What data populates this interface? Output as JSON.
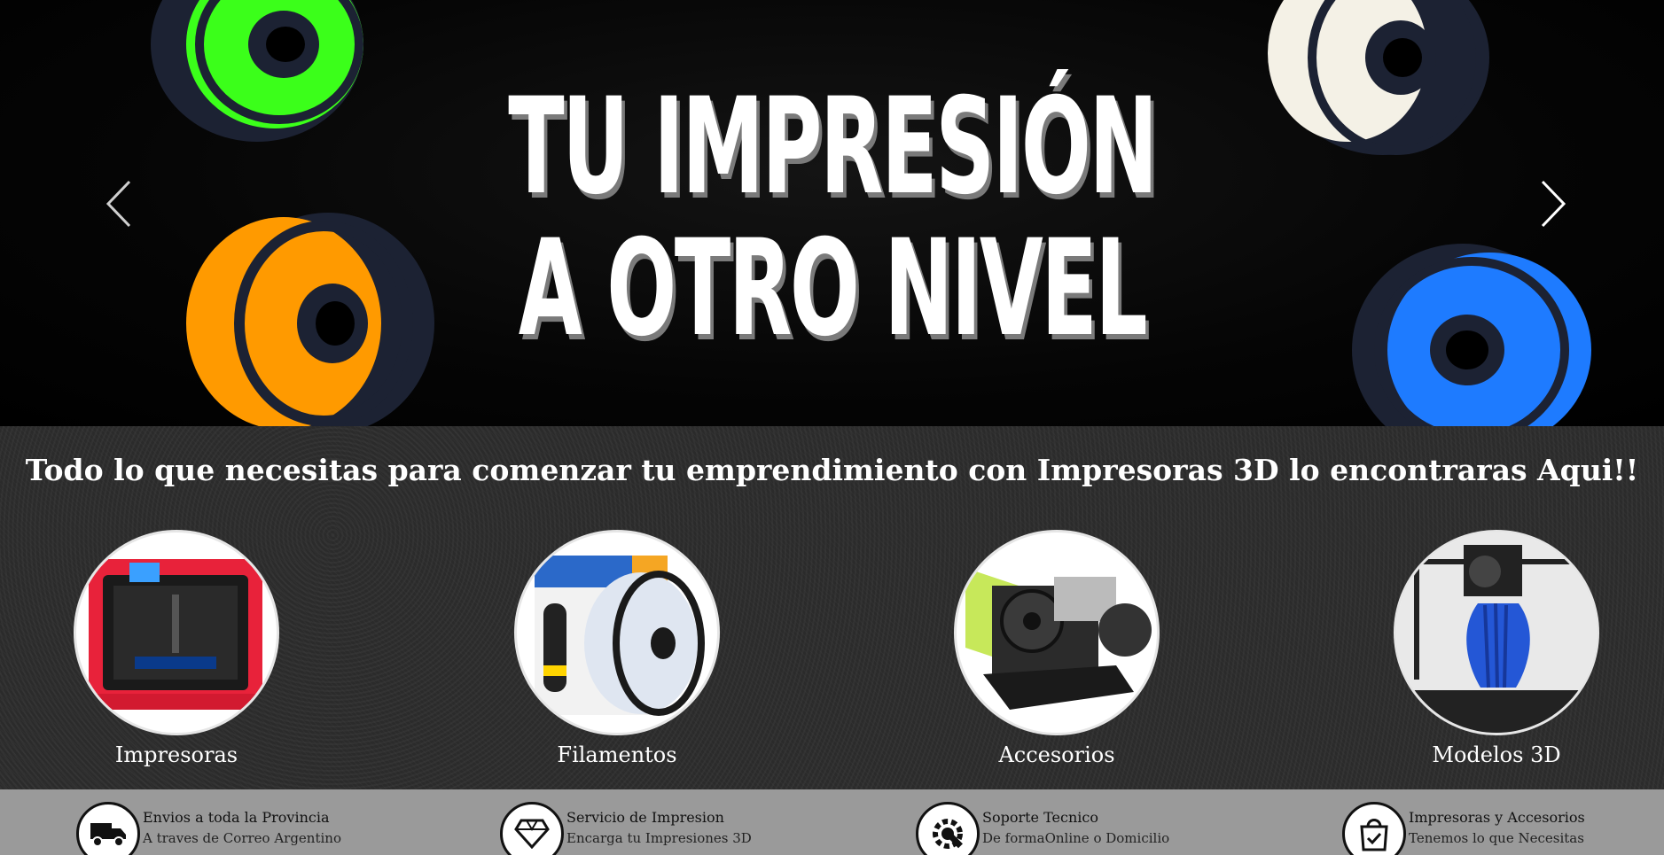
{
  "hero": {
    "title_line1": "TU IMPRESIÓN",
    "title_line2": "A OTRO NIVEL",
    "prev_icon": "chevron-left-icon",
    "next_icon": "chevron-right-icon"
  },
  "categories": {
    "heading": "Todo lo que necesitas para comenzar tu emprendimiento con Impresoras 3D lo encontraras Aqui!!",
    "items": [
      {
        "label": "Impresoras"
      },
      {
        "label": "Filamentos"
      },
      {
        "label": "Accesorios"
      },
      {
        "label": "Modelos 3D"
      }
    ]
  },
  "features": [
    {
      "icon": "truck-icon",
      "title": "Envios a toda la Provincia",
      "subtitle": "A traves de Correo Argentino"
    },
    {
      "icon": "diamond-icon",
      "title": "Servicio de Impresion",
      "subtitle": "Encarga tu Impresiones 3D"
    },
    {
      "icon": "gear-wrench-icon",
      "title": "Soporte Tecnico",
      "subtitle": "De formaOnline o Domicilio"
    },
    {
      "icon": "shopping-bag-check-icon",
      "title": "Impresoras y Accesorios",
      "subtitle": "Tenemos lo que Necesitas"
    }
  ],
  "colors": {
    "spool_green": "#3bff1a",
    "spool_orange": "#ff9a00",
    "spool_white": "#f4f1e6",
    "spool_blue": "#1e7bff",
    "spool_frame": "#1c2233"
  }
}
